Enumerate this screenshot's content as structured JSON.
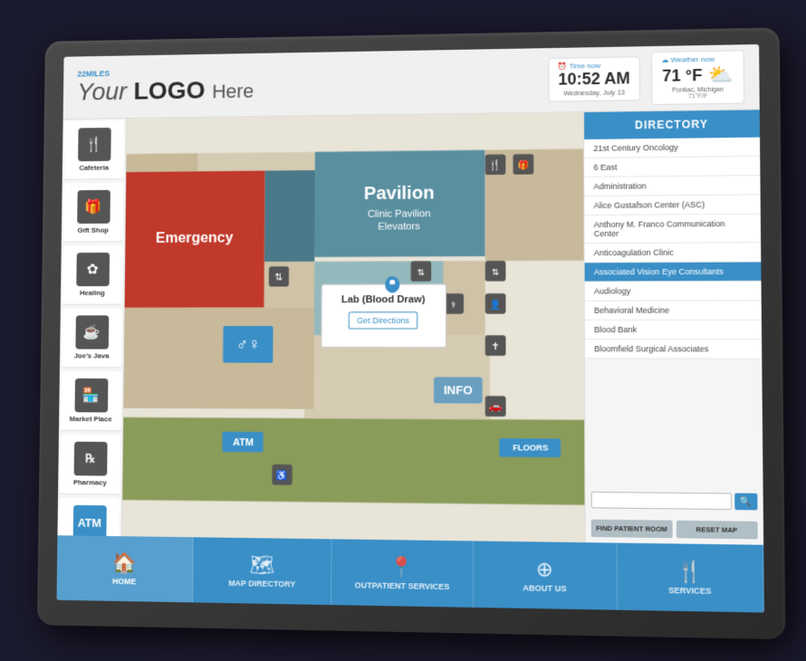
{
  "header": {
    "logo_brand": "22MILES",
    "logo_your": "Your ",
    "logo_main": "LOGO",
    "logo_here": "Here",
    "time_label": "⏰ Time now",
    "time_value": "10:52 AM",
    "time_date": "Wednesday, July 13",
    "weather_label": "☁ Weather now",
    "weather_value": "71 °F",
    "weather_location": "Pontiac, Michigan",
    "weather_desc": "71°F/F"
  },
  "sidebar": {
    "items": [
      {
        "id": "cafeteria",
        "icon": "🍴",
        "label": "Cafeteria"
      },
      {
        "id": "gift-shop",
        "icon": "🎁",
        "label": "Gift Shop"
      },
      {
        "id": "healing",
        "icon": "✿",
        "label": "Healing"
      },
      {
        "id": "joes-java",
        "icon": "☕",
        "label": "Joe's Java"
      },
      {
        "id": "market-place",
        "icon": "🏪",
        "label": "Market Place"
      },
      {
        "id": "pharmacy",
        "icon": "℞",
        "label": "Pharmacy"
      },
      {
        "id": "atm",
        "icon": "ATM",
        "label": "ATM",
        "special": true
      }
    ]
  },
  "map": {
    "popup_title": "Lab (Blood Draw)",
    "popup_directions": "Get Directions",
    "pavilion_label": "Pavilion",
    "emergency_label": "Emergency",
    "info_label": "INFO",
    "floors_label": "FLOORS",
    "atm_label": "ATM"
  },
  "directory": {
    "header": "DIRECTORY",
    "items": [
      {
        "label": "21st Century Oncology",
        "active": false
      },
      {
        "label": "6 East",
        "active": false
      },
      {
        "label": "Administration",
        "active": false
      },
      {
        "label": "Alice Gustafson Center (ASC)",
        "active": false
      },
      {
        "label": "Anthony M. Franco Communication Center",
        "active": false
      },
      {
        "label": "Anticoagulation Clinic",
        "active": false
      },
      {
        "label": "Associated Vision Eye Consultants",
        "active": true
      },
      {
        "label": "Audiology",
        "active": false
      },
      {
        "label": "Behavioral Medicine",
        "active": false
      },
      {
        "label": "Blood Bank",
        "active": false
      },
      {
        "label": "Bloomfield Surgical Associates",
        "active": false
      }
    ],
    "search_placeholder": "",
    "find_patient_room": "FIND PATIENT ROOM",
    "reset_map": "RESET MAP"
  },
  "bottom_nav": {
    "items": [
      {
        "id": "home",
        "icon": "🏠",
        "label": "HOME",
        "active": true
      },
      {
        "id": "map-directory",
        "icon": "🗺",
        "label": "MAP DIRECTORY",
        "active": false
      },
      {
        "id": "outpatient",
        "icon": "📍",
        "label": "OUTPATIENT SERVICES",
        "active": false
      },
      {
        "id": "about-us",
        "icon": "⊕",
        "label": "ABOUT US",
        "active": false
      },
      {
        "id": "services",
        "icon": "🍴",
        "label": "SERVICES",
        "active": false
      }
    ]
  }
}
